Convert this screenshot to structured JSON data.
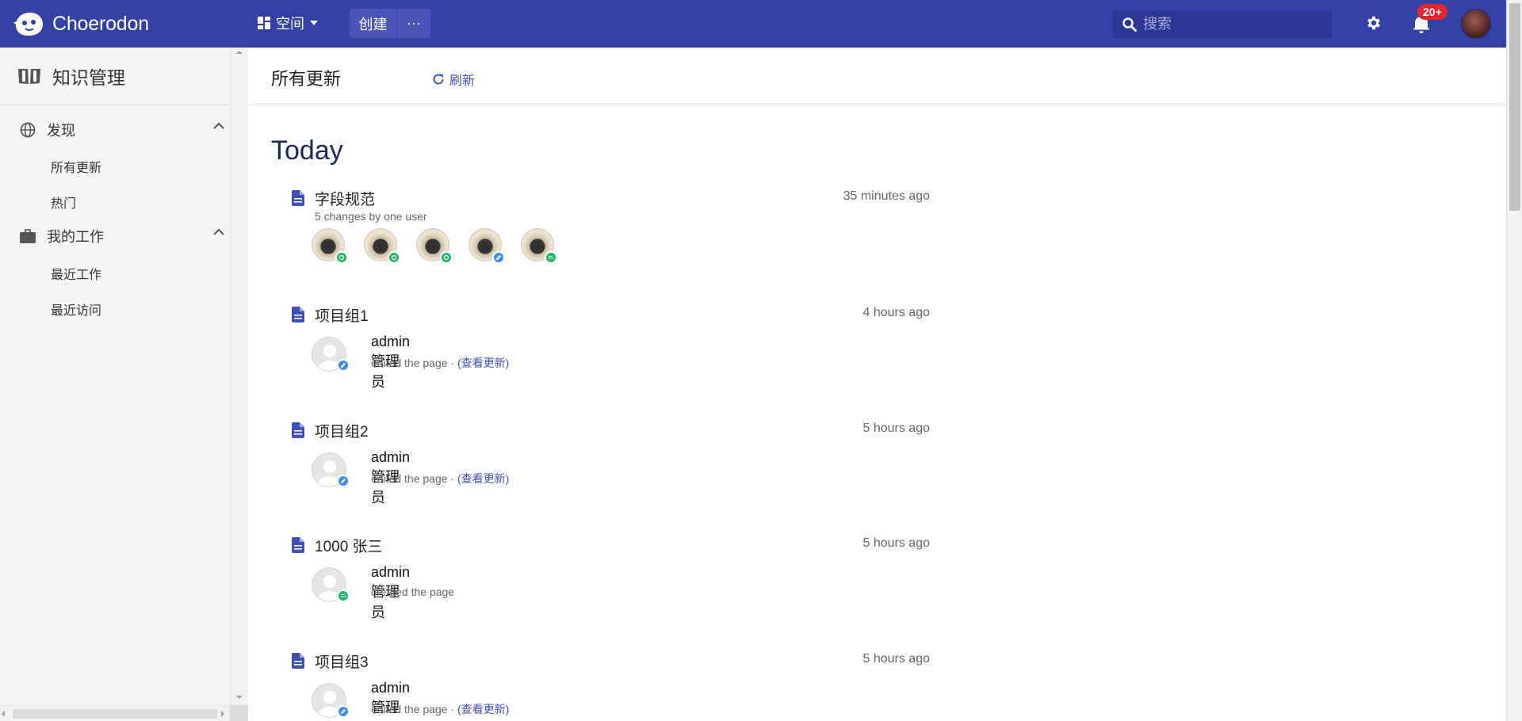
{
  "app": {
    "name": "Choerodon"
  },
  "topbar": {
    "space_label": "空间",
    "create_label": "创建",
    "more_label": "···",
    "search_placeholder": "搜索",
    "notification_badge": "20+"
  },
  "sidebar": {
    "title": "知识管理",
    "groups": [
      {
        "label": "发现",
        "items": [
          "所有更新",
          "热门"
        ]
      },
      {
        "label": "我的工作",
        "items": [
          "最近工作",
          "最近访问"
        ]
      }
    ]
  },
  "main": {
    "title": "所有更新",
    "refresh_label": "刷新",
    "day_label": "Today",
    "items": [
      {
        "title": "字段规范",
        "time": "35 minutes ago",
        "summary": "5 changes by one user"
      },
      {
        "title": "项目组1",
        "time": "4 hours ago",
        "user": "admin 管理员",
        "action": "edited the page",
        "sep": " · ",
        "link": "(查看更新)"
      },
      {
        "title": "项目组2",
        "time": "5 hours ago",
        "user": "admin 管理员",
        "action": "edited the page",
        "sep": " · ",
        "link": "(查看更新)"
      },
      {
        "title": "1000 张三",
        "time": "5 hours ago",
        "user": "admin 管理员",
        "action": "created the page"
      },
      {
        "title": "项目组3",
        "time": "5 hours ago",
        "user": "admin 管理员",
        "action": "edited the page",
        "sep": " · ",
        "link": "(查看更新)"
      }
    ]
  },
  "colors": {
    "topbar": "#3340a5",
    "accent": "#3f51b5",
    "badge": "#e8262d",
    "green": "#1fb86b",
    "blue": "#3f8df5"
  }
}
